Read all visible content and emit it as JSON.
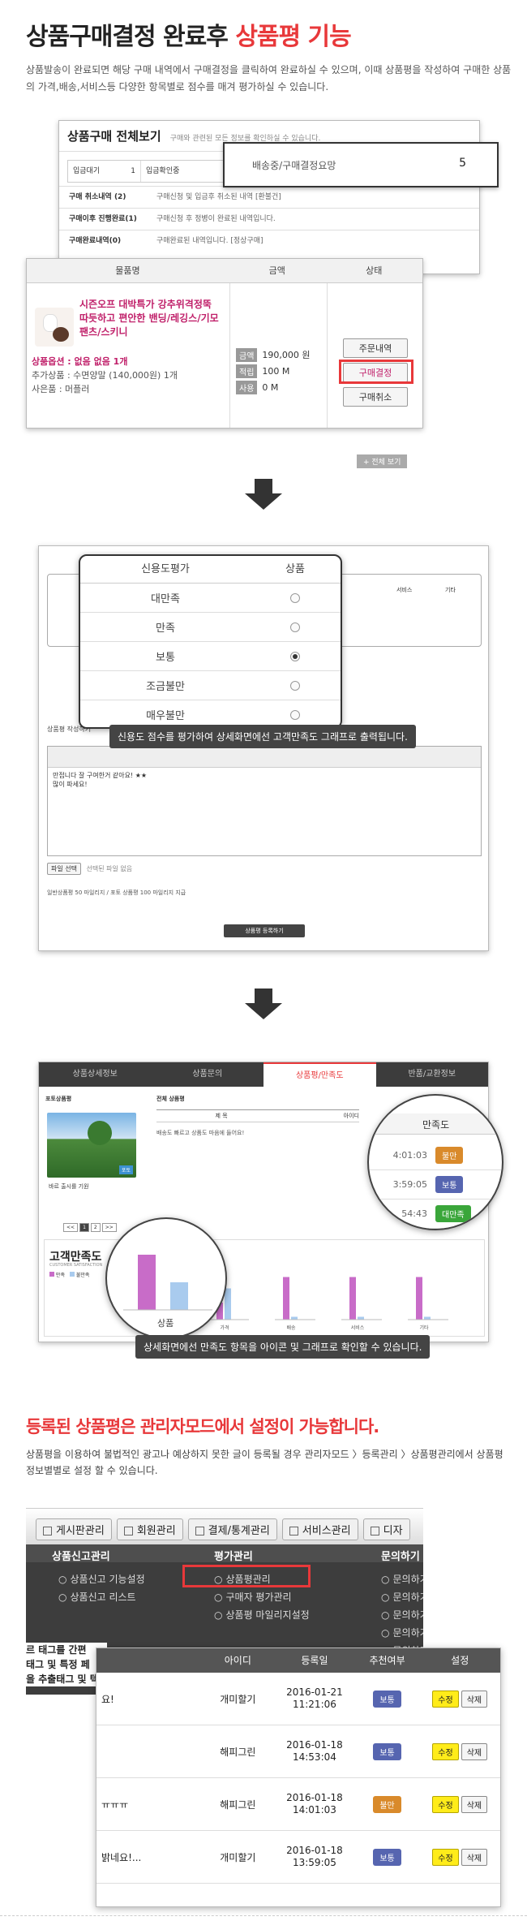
{
  "section1": {
    "title_prefix": "상품구매결정 완료후",
    "title_highlight": "상품평 기능",
    "desc": "상품발송이 완료되면 해당 구매 내역에서 구매결정을 클릭하여 완료하실 수 있으며, 이때 상품평을 작성하여 구매한 상품의 가격,배송,서비스등 다양한 항목별로 점수를 매겨 평가하실 수 있습니다."
  },
  "purchase_view": {
    "title": "상품구매 전체보기",
    "subtitle": "구매와 관련된 모든 정보를 확인하실 수 있습니다.",
    "stats": [
      {
        "label": "입금대기",
        "value": "1"
      },
      {
        "label": "입금확인중",
        "value": ""
      }
    ],
    "status_label": "배송중/구매결정요망",
    "status_count": "5",
    "rows": [
      {
        "label": "구매 취소내역 (2)",
        "text": "구매신청 및 입금후 취소된 내역 [환불건]"
      },
      {
        "label": "구매이후 진행완료(1)",
        "text": "구매신청 후 정병이 완료된 내역입니다."
      },
      {
        "label": "구매완료내역(0)",
        "text": "구매완료된 내역입니다. [정상구매]"
      }
    ]
  },
  "order_detail": {
    "headers": [
      "물품명",
      "금액",
      "상태"
    ],
    "product_name": "시즌오프 대박특가 강추위격정뚝 따듯하고 편안한 밴딩/레깅스/기모팬츠/스키니",
    "option": "상품옵션 : 없음 없음 1개",
    "extra": "추가상품 : 수면양말 (140,000원) 1개",
    "gift": "사은품 : 머플러",
    "price_rows": [
      {
        "tag": "금액",
        "value": "190,000 원"
      },
      {
        "tag": "적립",
        "value": "100 M"
      },
      {
        "tag": "사용",
        "value": "0 M"
      }
    ],
    "buttons": [
      "주문내역",
      "구매결정",
      "구매취소"
    ],
    "below_btn": "+ 전체 보기"
  },
  "rating_popup": {
    "col1": "신용도평가",
    "col2": "상품",
    "options": [
      {
        "label": "대만족",
        "checked": false
      },
      {
        "label": "만족",
        "checked": false
      },
      {
        "label": "보통",
        "checked": true
      },
      {
        "label": "조금불만",
        "checked": false
      },
      {
        "label": "매우불만",
        "checked": false
      }
    ],
    "tooltip": "신용도 점수를 평가하여 상세화면에선 고객만족도 그래프로 출력됩니다.",
    "bg_cols": [
      "서비스",
      "기타"
    ],
    "editor_text_1": "만접니다 잘 구여한거 같아요! ★★",
    "editor_text_2": "많이 파세요!",
    "attach_label": "파일 선택",
    "attach_hint": "선택된 파일 없음",
    "submit": "상품평 등록하기",
    "points_note": "일반상품평 50 마일리지 / 포토 상품평 100 마일리지 지급",
    "write_label": "상품평 작성하기"
  },
  "detail_view": {
    "tabs": [
      "상품상세정보",
      "상품문의",
      "상품평/만족도",
      "반품/교환정보"
    ],
    "photo_title": "포토상품평",
    "photo_caption": "바르 출시를 기원",
    "list_title": "전체 상품평",
    "list_headers": [
      "제 목",
      "아이디"
    ],
    "list_row": "배송도 빠르고 상품도 마음에 들어요!",
    "satisfaction_head": "만족도",
    "satisfaction": [
      {
        "time": "4:01:03",
        "label": "불만"
      },
      {
        "time": "3:59:05",
        "label": "보통"
      },
      {
        "time": "54:43",
        "label": "대만족"
      }
    ],
    "chart_title": "고객만족도",
    "chart_sub": "CUSTOMER SATISFACTION",
    "legend": [
      "만족",
      "불만족"
    ],
    "chart_cats": [
      "상품",
      "가격",
      "배송",
      "서비스",
      "기타"
    ],
    "zoom_label": "상품",
    "tooltip": "상세화면에선 만족도 항목을 아이콘 및 그래프로 확인할 수 있습니다.",
    "pages": [
      "<<",
      "1",
      "2",
      ">>"
    ]
  },
  "chart_data": {
    "type": "bar",
    "categories": [
      "상품",
      "가격",
      "배송",
      "서비스",
      "기타"
    ],
    "series": [
      {
        "name": "만족",
        "values": [
          80,
          30,
          75,
          75,
          75
        ]
      },
      {
        "name": "불만족",
        "values": [
          40,
          55,
          5,
          5,
          5
        ]
      }
    ],
    "title": "고객만족도",
    "ylim": [
      0,
      100
    ]
  },
  "section2": {
    "title": "등록된 상품평은 관리자모드에서 설정이 가능합니다.",
    "desc": "상품평을 이용하여 불법적인 광고나 예상하지 못한 글이 등록될 경우 관리자모드 〉등록관리 〉상품평관리에서 상품평 정보별별로 설정 할 수 있습니다."
  },
  "admin": {
    "menus": [
      "게시판관리",
      "회원관리",
      "결제/통계관리",
      "서비스관리",
      "디자"
    ],
    "col1_title": "상품신고관리",
    "col1_items": [
      "상품신고 기능설정",
      "상품신고 리스트"
    ],
    "col2_title": "평가관리",
    "col2_items": [
      "상품평관리",
      "구매자 평가관리",
      "상품평 마일리지설정"
    ],
    "col3_title": "문의하기",
    "col3_items": [
      "문의하기",
      "문의하기",
      "문의하기",
      "문의하기",
      "문의하기"
    ],
    "left_frag": [
      "르 태그를 간편",
      "태그 및 특정 페",
      "을 추출태그 및 텍"
    ],
    "table_headers": [
      "아이디",
      "등록일",
      "추천여부",
      "설정"
    ],
    "rows": [
      {
        "frag": "요!",
        "id": "개미할기",
        "date": "2016-01-21",
        "time": "11:21:06",
        "rec": "보통",
        "recType": "mid"
      },
      {
        "frag": "",
        "id": "해피그린",
        "date": "2016-01-18",
        "time": "14:53:04",
        "rec": "보통",
        "recType": "mid"
      },
      {
        "frag": "ㅠㅠㅠ",
        "id": "해피그린",
        "date": "2016-01-18",
        "time": "14:01:03",
        "rec": "불만",
        "recType": "bad"
      },
      {
        "frag": "밝네요!...",
        "id": "개미할기",
        "date": "2016-01-18",
        "time": "13:59:05",
        "rec": "보통",
        "recType": "mid"
      }
    ],
    "edit": "수정",
    "delete": "삭제"
  },
  "colors": {
    "accent": "#e8383a",
    "good": "#3aa63a",
    "mid": "#5665b0",
    "bad": "#d98a2b",
    "bar_pink": "#c86cc8",
    "bar_blue": "#a9cbee"
  }
}
